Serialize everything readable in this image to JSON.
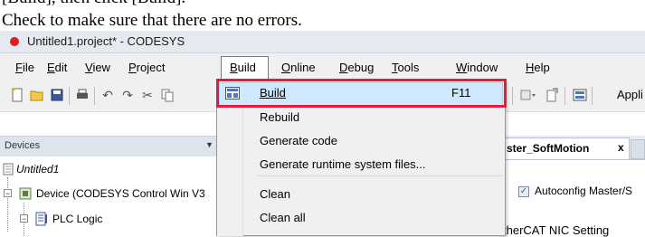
{
  "caption": {
    "cut_text": "[Build], then click [Build].",
    "text": "Check to make sure that there are no errors."
  },
  "window": {
    "title": "Untitled1.project* - CODESYS"
  },
  "menubar": {
    "items": [
      {
        "label": "File"
      },
      {
        "label": "Edit"
      },
      {
        "label": "View"
      },
      {
        "label": "Project"
      },
      {
        "label": "Build"
      },
      {
        "label": "Online"
      },
      {
        "label": "Debug"
      },
      {
        "label": "Tools"
      },
      {
        "label": "Window"
      },
      {
        "label": "Help"
      }
    ]
  },
  "toolbar": {
    "truncated_label": "Appli"
  },
  "build_menu": {
    "items": [
      {
        "label": "Build",
        "shortcut": "F11"
      },
      {
        "label": "Rebuild"
      },
      {
        "label": "Generate code"
      },
      {
        "label": "Generate runtime system files..."
      },
      {
        "label": "Clean"
      },
      {
        "label": "Clean all"
      }
    ],
    "highlight_color": "#cde8ff",
    "callout_color": "#e31c3d"
  },
  "devices_panel": {
    "title": "Devices",
    "tree": {
      "root": "Untitled1",
      "device": "Device (CODESYS Control Win V3",
      "plc_logic": "PLC Logic"
    }
  },
  "editor": {
    "tab_label": "ster_SoftMotion",
    "tab_close": "x",
    "checkbox_label": "Autoconfig Master/S",
    "checkbox_checked": true,
    "section_label": "therCAT NIC Setting"
  }
}
